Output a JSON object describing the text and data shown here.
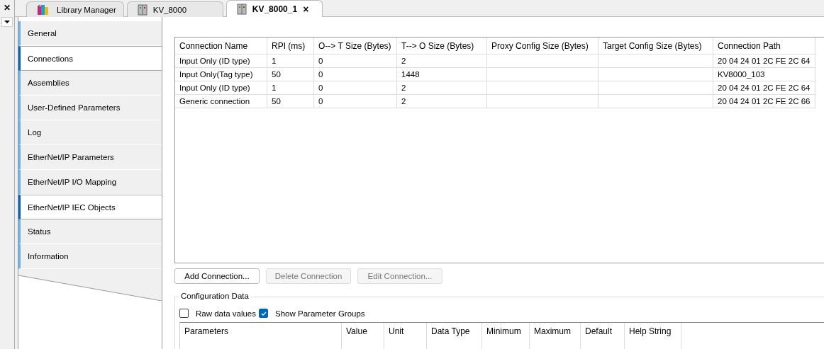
{
  "doc_tabs": [
    {
      "label": "Library Manager",
      "kind": "books",
      "selected": false,
      "closable": false
    },
    {
      "label": "KV_8000",
      "kind": "device",
      "selected": false,
      "closable": false
    },
    {
      "label": "KV_8000_1",
      "kind": "device",
      "selected": true,
      "closable": true
    }
  ],
  "close_glyph": "×",
  "pane_close_glyph": "✕",
  "side_tabs": [
    {
      "label": "General",
      "selected": false
    },
    {
      "label": "Connections",
      "selected": true
    },
    {
      "label": "Assemblies",
      "selected": false
    },
    {
      "label": "User-Defined Parameters",
      "selected": false
    },
    {
      "label": "Log",
      "selected": false
    },
    {
      "label": "EtherNet/IP Parameters",
      "selected": false
    },
    {
      "label": "EtherNet/IP I/O Mapping",
      "selected": false
    },
    {
      "label": "EtherNet/IP IEC Objects",
      "selected": true
    },
    {
      "label": "Status",
      "selected": false
    },
    {
      "label": "Information",
      "selected": false
    }
  ],
  "connections_table": {
    "columns": [
      "Connection Name",
      "RPI (ms)",
      "O--> T Size (Bytes)",
      "T--> O Size (Bytes)",
      "Proxy Config Size (Bytes)",
      "Target Config Size (Bytes)",
      "Connection Path"
    ],
    "rows": [
      [
        "Input Only (ID type)",
        "1",
        "0",
        "2",
        "",
        "",
        "20 04 24 01 2C FE 2C 64"
      ],
      [
        "Input Only(Tag type)",
        "50",
        "0",
        "1448",
        "",
        "",
        "KV8000_103"
      ],
      [
        "Input Only (ID type)",
        "1",
        "0",
        "2",
        "",
        "",
        "20 04 24 01 2C FE 2C 64"
      ],
      [
        "Generic connection",
        "50",
        "0",
        "2",
        "",
        "",
        "20 04 24 01 2C FE 2C 66"
      ]
    ]
  },
  "buttons": [
    {
      "label": "Add Connection...",
      "disabled": false
    },
    {
      "label": "Delete Connection",
      "disabled": true
    },
    {
      "label": "Edit Connection...",
      "disabled": true
    }
  ],
  "configuration_data": {
    "title": "Configuration Data",
    "options": [
      {
        "label": "Raw data values",
        "checked": false
      },
      {
        "label": "Show Parameter Groups",
        "checked": true
      }
    ],
    "columns": [
      "Parameters",
      "Value",
      "Unit",
      "Data Type",
      "Minimum",
      "Maximum",
      "Default",
      "Help String"
    ]
  }
}
